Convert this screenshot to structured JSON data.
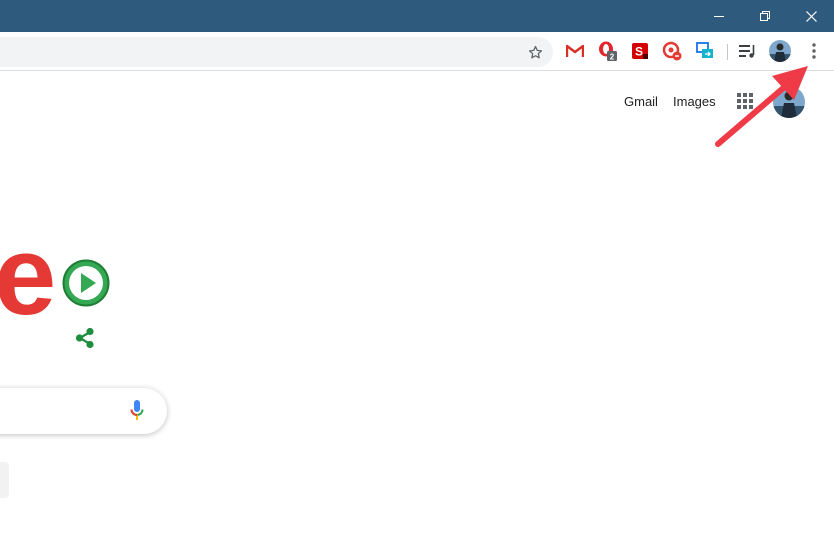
{
  "window": {
    "minimize_icon": "minimize-icon",
    "restore_icon": "restore-icon",
    "close_icon": "close-icon",
    "titlebar_color": "#2e5a7d"
  },
  "toolbar": {
    "bookmark_icon": "star-icon",
    "extensions": [
      {
        "name": "gmail-extension",
        "icon": "gmail-icon"
      },
      {
        "name": "opera-extension",
        "icon": "opera-icon",
        "badge": "2"
      },
      {
        "name": "s-extension",
        "icon": "s-icon",
        "label": "S"
      },
      {
        "name": "red-extension",
        "icon": "red-badge-icon"
      },
      {
        "name": "screen-share-extension",
        "icon": "screen-share-icon"
      }
    ],
    "media_icon": "media-queue-icon",
    "menu_icon": "three-dot-menu-icon"
  },
  "page": {
    "gmail_link": "Gmail",
    "images_link": "Images",
    "doodle_letter": "e",
    "colors": {
      "doodle_red": "#e53935",
      "play_green": "#34a853",
      "share_green": "#1e8e3e",
      "annotation_arrow": "#ef3b47"
    }
  }
}
